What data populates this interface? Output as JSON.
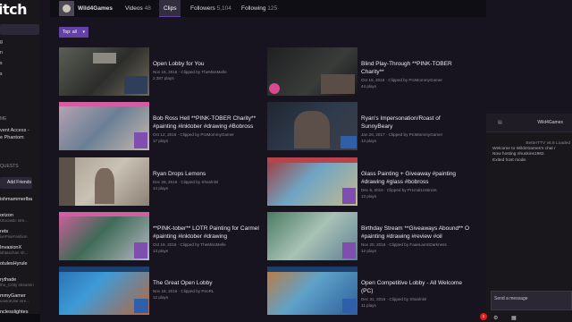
{
  "sidebar": {
    "logo": "itch",
    "nav": [
      "g",
      "n",
      "s",
      "s"
    ],
    "section_game": "ME",
    "game_line1": "vent Access -",
    "game_line2": "e Phantom",
    "section_requests": "QUESTS",
    "add_friends": "Add Friends",
    "friends": [
      {
        "name": "ishmammerlba",
        "status": ""
      },
      {
        "name": "orizon",
        "status": "Utocastic stre..."
      },
      {
        "name": "rets",
        "status": "ivePixeFashion"
      },
      {
        "name": "InvasionX",
        "status": "ishtaschan sh..."
      },
      {
        "name": "otulesHyrule",
        "status": ""
      },
      {
        "name": "rythade",
        "status": "the_Critty streamin"
      },
      {
        "name": "mmyGamer",
        "status": "vastorUlar stre..."
      },
      {
        "name": "nclesslightes",
        "status": ""
      }
    ]
  },
  "header": {
    "channel": "Wild4Games",
    "videos_label": "Videos",
    "videos_count": "48",
    "clips_label": "Clips",
    "followers_label": "Followers",
    "followers_count": "5,104",
    "following_label": "Following",
    "following_count": "125"
  },
  "sort": {
    "label": "Top: all"
  },
  "clips": [
    {
      "title": "Open Lobby for You",
      "date": "Nov 15, 2016",
      "clipped_by": "TheMissMelle",
      "plays": "2,387 plays"
    },
    {
      "title": "Blind Play-Through **PINK-TOBER Charity**",
      "date": "Oct 15, 2016",
      "clipped_by": "ProMommyGamer",
      "plays": "44 plays"
    },
    {
      "title": "Bob Ross Hell **PINK-TOBER Charity** #painting #inktober #drawing #Bobross",
      "date": "Oct 12, 2016",
      "clipped_by": "ProMommyGamer",
      "plays": "17 plays"
    },
    {
      "title": "Ryan's Impersonation/Roast of SunnyBeary",
      "date": "Jan 26, 2017",
      "clipped_by": "ProMommyGamer",
      "plays": "14 plays"
    },
    {
      "title": "Ryan Drops Lemons",
      "date": "Dec 29, 2016",
      "clipped_by": "Shanlnlnl",
      "plays": "14 plays"
    },
    {
      "title": "Glass Painting + Giveaway #painting #drawing #glass #bobross",
      "date": "Dec 6, 2016",
      "clipped_by": "Pr1mal1nstincts",
      "plays": "13 plays"
    },
    {
      "title": "**PINK-tober** LOTR Painting for Carmel #painting #inktober #drawing",
      "date": "Oct 19, 2016",
      "clipped_by": "TheMissMelle",
      "plays": "13 plays"
    },
    {
      "title": "Birthday Stream **Giveaways Abound** O #painting #drawing #review #oil",
      "date": "Nov 20, 2016",
      "clipped_by": "FaaeLaeInDarkness",
      "plays": "12 plays"
    },
    {
      "title": "The Great Open Lobby",
      "date": "Nov 18, 2016",
      "clipped_by": "PeoRL",
      "plays": "12 plays"
    },
    {
      "title": "Open Competitive Lobby - All Welcome (PC)",
      "date": "Dec 31, 2016",
      "clipped_by": "Shanlnlnl",
      "plays": "11 plays"
    }
  ],
  "chat": {
    "title": "Wild4Games",
    "lines": [
      "BetterTTV v6.8 Loaded",
      "Welcome to Wild4Games's chat r",
      "Now hosting nhunkins1982.",
      "Exited host mode."
    ],
    "input_placeholder": "Send a message",
    "notif_count": "1"
  }
}
